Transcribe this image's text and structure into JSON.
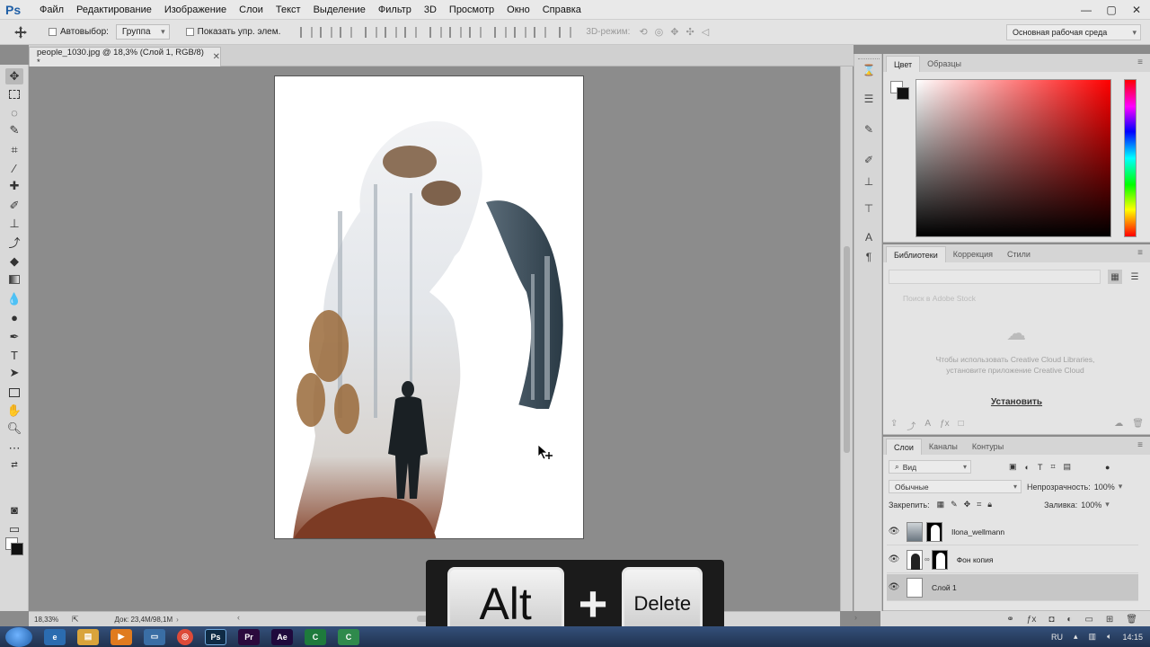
{
  "app": {
    "logo": "Ps"
  },
  "menu": [
    "Файл",
    "Редактирование",
    "Изображение",
    "Слои",
    "Текст",
    "Выделение",
    "Фильтр",
    "3D",
    "Просмотр",
    "Окно",
    "Справка"
  ],
  "window_controls": {
    "minimize": "—",
    "restore": "▢",
    "close": "✕"
  },
  "options": {
    "autoselect_label": "Автовыбор:",
    "autoselect_value": "Группа",
    "show_transform_label": "Показать упр. элем.",
    "mode_3d": "3D-режим:",
    "workspace": "Основная рабочая среда"
  },
  "document": {
    "tab_title": "people_1030.jpg @ 18,3% (Слой 1, RGB/8) *",
    "tab_close": "✕"
  },
  "status": {
    "zoom": "18,33%",
    "doc_info": "Док: 23,4M/98,1M"
  },
  "keys": {
    "key1": "Alt",
    "plus": "+",
    "key2": "Delete"
  },
  "color_panel": {
    "tabs": [
      "Цвет",
      "Образцы"
    ],
    "foreground": "#ffffff",
    "background": "#111111",
    "hue": "#ff0000"
  },
  "libraries_panel": {
    "tabs": [
      "Библиотеки",
      "Коррекция",
      "Стили"
    ],
    "search_placeholder": "Поиск в Adobe Stock",
    "message": "Чтобы использовать Creative Cloud Libraries, установите приложение Creative Cloud",
    "install": "Установить"
  },
  "layers_panel": {
    "tabs": [
      "Слои",
      "Каналы",
      "Контуры"
    ],
    "filter_label": "Вид",
    "blend_mode": "Обычные",
    "opacity_label": "Непрозрачность:",
    "opacity_value": "100%",
    "lock_label": "Закрепить:",
    "fill_label": "Заливка:",
    "fill_value": "100%",
    "layers": [
      {
        "name": "Ilona_wellmann",
        "selected": false
      },
      {
        "name": "Фон копия",
        "selected": false
      },
      {
        "name": "Слой 1",
        "selected": true
      }
    ]
  },
  "taskbar": {
    "lang": "RU",
    "time": "14:15"
  }
}
